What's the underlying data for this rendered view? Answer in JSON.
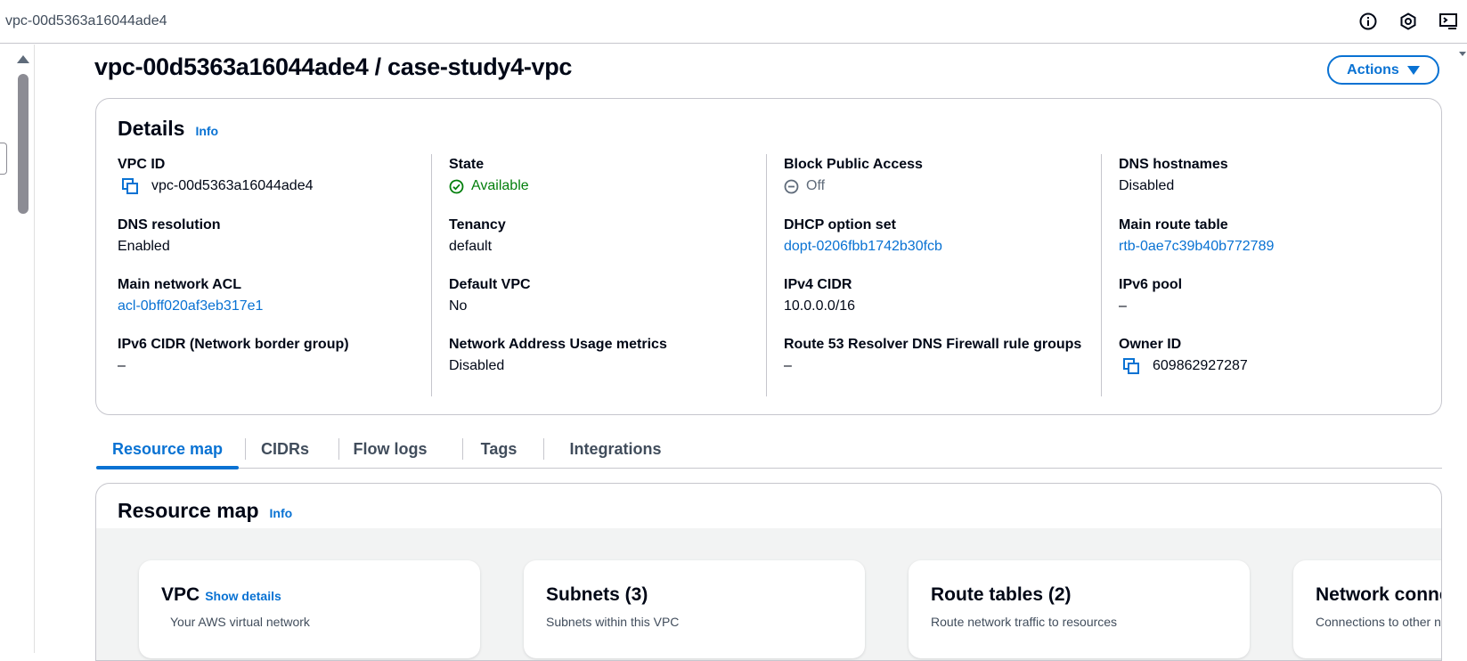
{
  "browser": {
    "tab_title": "vpc-00d5363a16044ade4",
    "tools": [
      {
        "name": "info-circle-icon"
      },
      {
        "name": "settings-hexagon-icon"
      },
      {
        "name": "cloudshell-icon"
      }
    ]
  },
  "header": {
    "title": "vpc-00d5363a16044ade4 / case-study4-vpc",
    "actions_label": "Actions"
  },
  "details": {
    "heading": "Details",
    "info": "Info",
    "columns": [
      [
        {
          "label": "VPC ID",
          "value": "vpc-00d5363a16044ade4",
          "copyable": true
        },
        {
          "label": "DNS resolution",
          "value": "Enabled"
        },
        {
          "label": "Main network ACL",
          "value": "acl-0bff020af3eb317e1",
          "link": true
        },
        {
          "label": "IPv6 CIDR (Network border group)",
          "value": "–"
        }
      ],
      [
        {
          "label": "State",
          "value": "Available",
          "status": "success"
        },
        {
          "label": "Tenancy",
          "value": "default"
        },
        {
          "label": "Default VPC",
          "value": "No"
        },
        {
          "label": "Network Address Usage metrics",
          "value": "Disabled"
        }
      ],
      [
        {
          "label": "Block Public Access",
          "value": "Off",
          "status": "off"
        },
        {
          "label": "DHCP option set",
          "value": "dopt-0206fbb1742b30fcb",
          "link": true
        },
        {
          "label": "IPv4 CIDR",
          "value": "10.0.0.0/16"
        },
        {
          "label": "Route 53 Resolver DNS Firewall rule groups",
          "value": "–"
        }
      ],
      [
        {
          "label": "DNS hostnames",
          "value": "Disabled"
        },
        {
          "label": "Main route table",
          "value": "rtb-0ae7c39b40b772789",
          "link": true
        },
        {
          "label": "IPv6 pool",
          "value": "–"
        },
        {
          "label": "Owner ID",
          "value": "609862927287",
          "copyable": true
        }
      ]
    ]
  },
  "tabs": [
    "Resource map",
    "CIDRs",
    "Flow logs",
    "Tags",
    "Integrations"
  ],
  "active_tab": "Resource map",
  "resource_map": {
    "heading": "Resource map",
    "info": "Info",
    "cards": [
      {
        "title": "VPC",
        "action": "Show details",
        "desc": "Your AWS virtual network"
      },
      {
        "title": "Subnets (3)",
        "desc": "Subnets within this VPC"
      },
      {
        "title": "Route tables (2)",
        "desc": "Route network traffic to resources"
      },
      {
        "title": "Network connections",
        "desc": "Connections to other networks"
      }
    ]
  },
  "colors": {
    "link": "#0972d3",
    "success": "#037f0c",
    "text": "#000716",
    "border": "#c6c6cd"
  }
}
